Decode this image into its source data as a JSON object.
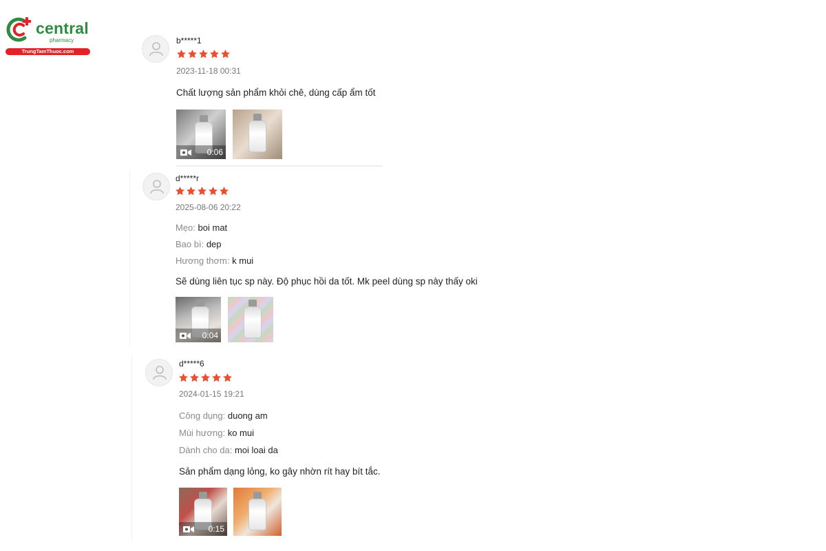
{
  "logo": {
    "word": "central",
    "sub": "pharmacy",
    "tagline": "TrungTamThuoc.com"
  },
  "colors": {
    "star": "#e8502f",
    "brand_green": "#2e8b3f",
    "brand_red": "#e32227"
  },
  "reviews": [
    {
      "user": "b*****1",
      "rating": 5,
      "date": "2023-11-18 00:31",
      "attributes": [],
      "comment": "Chất lượng sản phẩm khỏi chê, dùng cấp ẩm tốt",
      "media": [
        {
          "type": "video",
          "duration": "0:06"
        },
        {
          "type": "image"
        }
      ]
    },
    {
      "user": "d*****r",
      "rating": 5,
      "date": "2025-08-06 20:22",
      "attributes": [
        {
          "key": "Mẹo:",
          "value": "boi mat"
        },
        {
          "key": "Bao bì:",
          "value": "dep"
        },
        {
          "key": "Hương thơm:",
          "value": "k mui"
        }
      ],
      "comment": "Sẽ dùng liên tục sp này. Độ phục hồi da tốt. Mk peel dùng sp này thấy oki",
      "media": [
        {
          "type": "video",
          "duration": "0:04"
        },
        {
          "type": "image"
        }
      ]
    },
    {
      "user": "d*****6",
      "rating": 5,
      "date": "2024-01-15 19:21",
      "attributes": [
        {
          "key": "Công dụng:",
          "value": "duong am"
        },
        {
          "key": "Mùi hương:",
          "value": "ko mui"
        },
        {
          "key": "Dành cho da:",
          "value": "moi loai da"
        }
      ],
      "comment": "Sản phẩm dạng lỏng, ko gây nhờn rít hay bít tắc.",
      "media": [
        {
          "type": "video",
          "duration": "0:15"
        },
        {
          "type": "image"
        }
      ]
    }
  ]
}
